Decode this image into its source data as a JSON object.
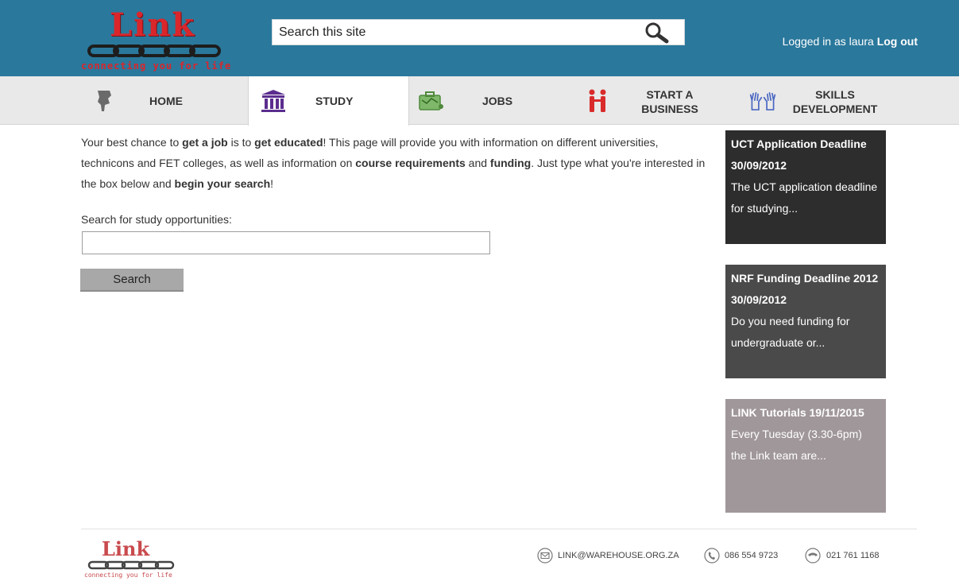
{
  "header": {
    "logo_word": "Link",
    "logo_tagline": "connecting you for life",
    "search_placeholder": "Search this site",
    "search_icon": "magnifier-icon",
    "login_prefix": "Logged in as laura",
    "logout_label": "Log out"
  },
  "nav": {
    "items": [
      {
        "label": "HOME",
        "icon": "home-pin-icon"
      },
      {
        "label": "STUDY",
        "icon": "institution-icon"
      },
      {
        "label": "JOBS",
        "icon": "briefcase-icon"
      },
      {
        "label_line1": "START A",
        "label_line2": "BUSINESS",
        "icon": "handshake-icon"
      },
      {
        "label_line1": "SKILLS",
        "label_line2": "DEVELOPMENT",
        "icon": "hands-icon"
      }
    ],
    "active": "STUDY"
  },
  "main": {
    "intro": {
      "p1": "Your best chance to ",
      "b1": "get a job",
      "p2": " is to ",
      "b2": "get educated",
      "p3": "! This page will provide you with information on different universities, technicons and FET colleges, as well as information on ",
      "b3": "course requirements",
      "p4": " and ",
      "b4": "funding",
      "p5": ". Just type what you're interested in the box below and ",
      "b5": "begin your search",
      "p6": "!"
    },
    "search_label": "Search for study opportunities:",
    "search_value": "",
    "search_button": "Search"
  },
  "sidebar": {
    "cards": [
      {
        "title": "UCT Application Deadline 30/09/2012",
        "desc": "The UCT application deadline for studying..."
      },
      {
        "title": "NRF Funding Deadline 2012 30/09/2012",
        "desc": "Do you need funding for undergraduate or..."
      },
      {
        "title": "LINK Tutorials 19/11/2015",
        "desc": "Every Tuesday (3.30-6pm) the Link team are..."
      }
    ]
  },
  "footer": {
    "logo_word": "Link",
    "logo_tagline": "connecting you for life",
    "email": "LINK@WAREHOUSE.ORG.ZA",
    "phone": "086 554 9723",
    "fax": "021 761 1168"
  },
  "colors": {
    "header_bg": "#2a789c",
    "logo_red": "#d9262b",
    "card1": "#2d2d2d",
    "card2": "#4a4a4a",
    "card3": "#a0979a"
  }
}
